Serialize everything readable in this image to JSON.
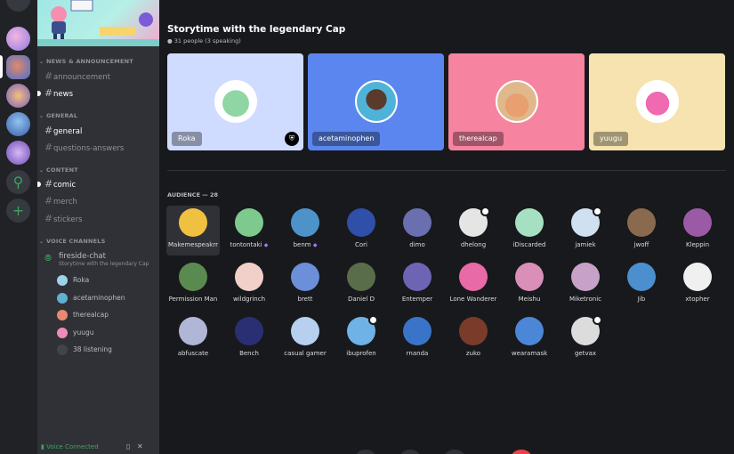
{
  "colors": {
    "accent_green": "#3ba55d",
    "background": "#18191c",
    "sidebar": "#2f3136",
    "rail": "#202225"
  },
  "rail": {
    "servers": [
      {
        "name": "server-1",
        "color": "#c9a8f0"
      },
      {
        "name": "server-2",
        "color": "#6b8cd9",
        "active": true
      },
      {
        "name": "server-3",
        "color": "#e0a15a"
      },
      {
        "name": "server-4",
        "color": "#4f7cc7"
      },
      {
        "name": "server-5",
        "color": "#a67ad6"
      }
    ],
    "search_icon": "search-icon",
    "add_icon": "plus-icon"
  },
  "sidebar": {
    "categories": {
      "news": "NEWS & ANNOUNCEMENT",
      "general": "GENERAL",
      "content": "CONTENT",
      "voice": "VOICE CHANNELS"
    },
    "channels": {
      "announcement": "announcement",
      "news": "news",
      "general": "general",
      "questions": "questions-answers",
      "comic": "comic",
      "merch": "merch",
      "stickers": "stickers"
    },
    "voice_channel": {
      "name": "fireside-chat",
      "subtitle": "Storytime with the legendary Cap",
      "speakers": [
        "Roka",
        "acetaminophen",
        "therealcap",
        "yuugu"
      ],
      "listening": "38 listening"
    },
    "voice_connected": "Voice Connected"
  },
  "stage": {
    "title": "Storytime with the legendary Cap",
    "count": "31 people (3 speaking)",
    "speakers": [
      {
        "name": "Roka",
        "bg": "#cfdcff"
      },
      {
        "name": "acetaminophen",
        "bg": "#5b86f0"
      },
      {
        "name": "therealcap",
        "bg": "#f683a0"
      },
      {
        "name": "yuugu",
        "bg": "#f6e3b0"
      }
    ],
    "audience_header": "AUDIENCE — 28",
    "audience": [
      {
        "name": "Makemespeakrr",
        "color": "#3f70d8"
      },
      {
        "name": "tontontaki",
        "color": "#7ec98e",
        "nitro": true
      },
      {
        "name": "benm",
        "color": "#4d93c9",
        "nitro": true
      },
      {
        "name": "Cori",
        "color": "#2f4fa8"
      },
      {
        "name": "dimo",
        "color": "#6a6fb0"
      },
      {
        "name": "dhelong",
        "color": "#e5e5e5"
      },
      {
        "name": "iDiscarded",
        "color": "#a6e0c2"
      },
      {
        "name": "jamiek",
        "color": "#cfe0f0"
      },
      {
        "name": "jwoff",
        "color": "#8a6a4e"
      },
      {
        "name": "Kleppin",
        "color": "#9b5aa6"
      },
      {
        "name": "Permission Man",
        "color": "#5b8a50"
      },
      {
        "name": "wildgrinch",
        "color": "#f0d0c8"
      },
      {
        "name": "brett",
        "color": "#6b8fd8"
      },
      {
        "name": "Daniel D",
        "color": "#5a6d4a"
      },
      {
        "name": "Entemper",
        "color": "#6e64b4"
      },
      {
        "name": "Lone Wanderer",
        "color": "#e86aa6"
      },
      {
        "name": "Meishu",
        "color": "#d98fb8"
      },
      {
        "name": "Miketronic",
        "color": "#c7a1c8"
      },
      {
        "name": "Jib",
        "color": "#4b8fcf"
      },
      {
        "name": "xtopher",
        "color": "#f0f0f0"
      },
      {
        "name": "abfuscate",
        "color": "#b0b6d6"
      },
      {
        "name": "Bench",
        "color": "#2a2f74"
      },
      {
        "name": "casual gamer",
        "color": "#b8d0f0"
      },
      {
        "name": "ibuprofen",
        "color": "#6fb2e6"
      },
      {
        "name": "rnanda",
        "color": "#3a74c8"
      },
      {
        "name": "zuko",
        "color": "#7a3b2a"
      },
      {
        "name": "wearamask",
        "color": "#4c86d6"
      },
      {
        "name": "getvax",
        "color": "#dcdcdc"
      }
    ]
  }
}
